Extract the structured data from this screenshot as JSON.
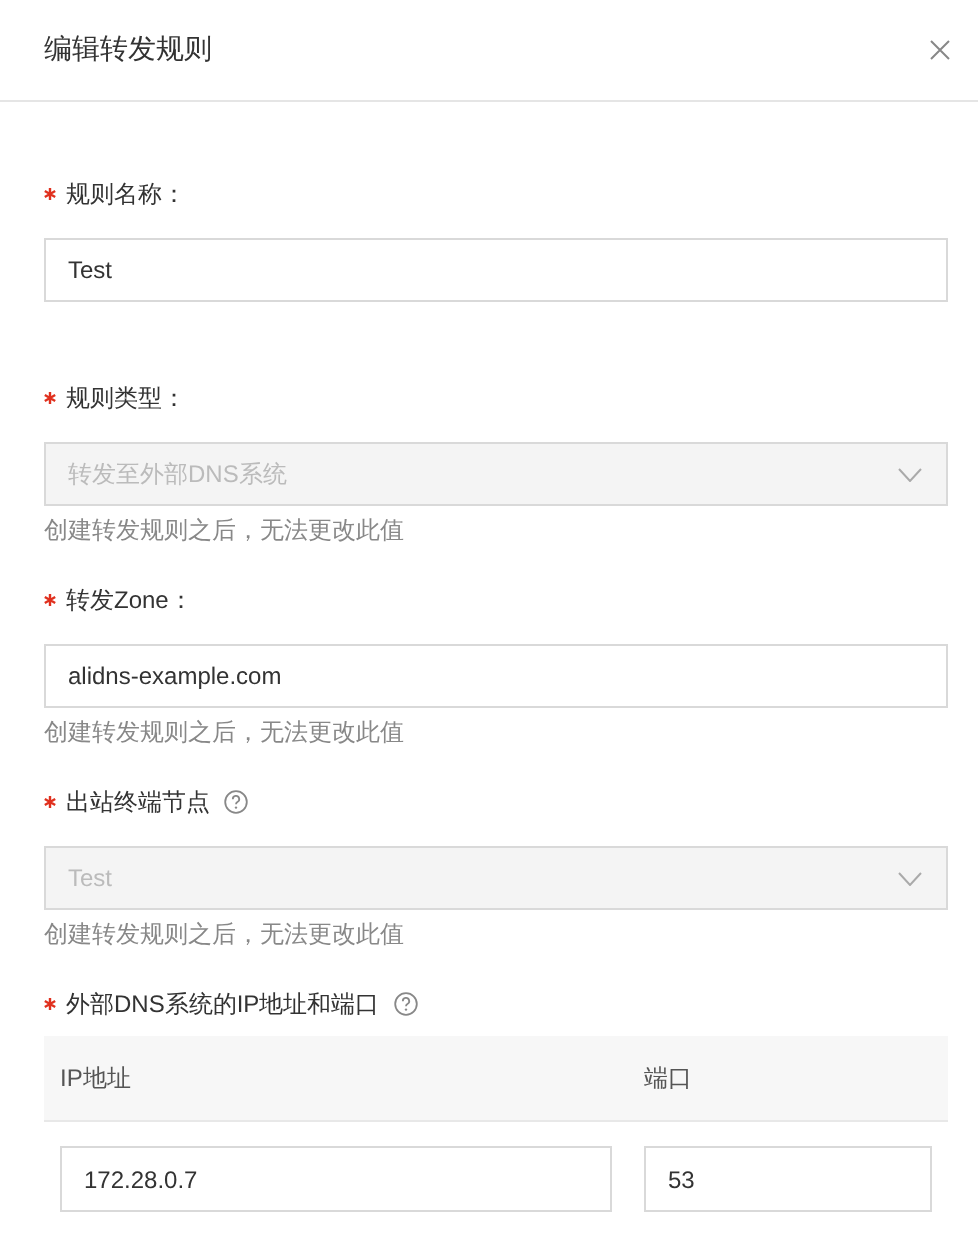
{
  "dialog": {
    "title": "编辑转发规则"
  },
  "fields": [
    {
      "kind": "text",
      "label": "规则名称：",
      "required": true,
      "help": false,
      "value": "Test",
      "disabled": false
    },
    {
      "kind": "select",
      "label": "规则类型：",
      "required": true,
      "help": false,
      "value": "转发至外部DNS系统",
      "disabled": true,
      "hint": "创建转发规则之后，无法更改此值"
    },
    {
      "kind": "text",
      "label": "转发Zone：",
      "required": true,
      "help": false,
      "value": "alidns-example.com",
      "disabled": false,
      "hint": "创建转发规则之后，无法更改此值"
    },
    {
      "kind": "select",
      "label": "出站终端节点",
      "required": true,
      "help": true,
      "value": "Test",
      "disabled": true,
      "hint": "创建转发规则之后，无法更改此值"
    },
    {
      "kind": "table",
      "label": "外部DNS系统的IP地址和端口",
      "required": true,
      "help": true,
      "columns": [
        "IP地址",
        "端口"
      ],
      "rows": [
        [
          "172.28.0.7",
          "53"
        ]
      ]
    }
  ]
}
